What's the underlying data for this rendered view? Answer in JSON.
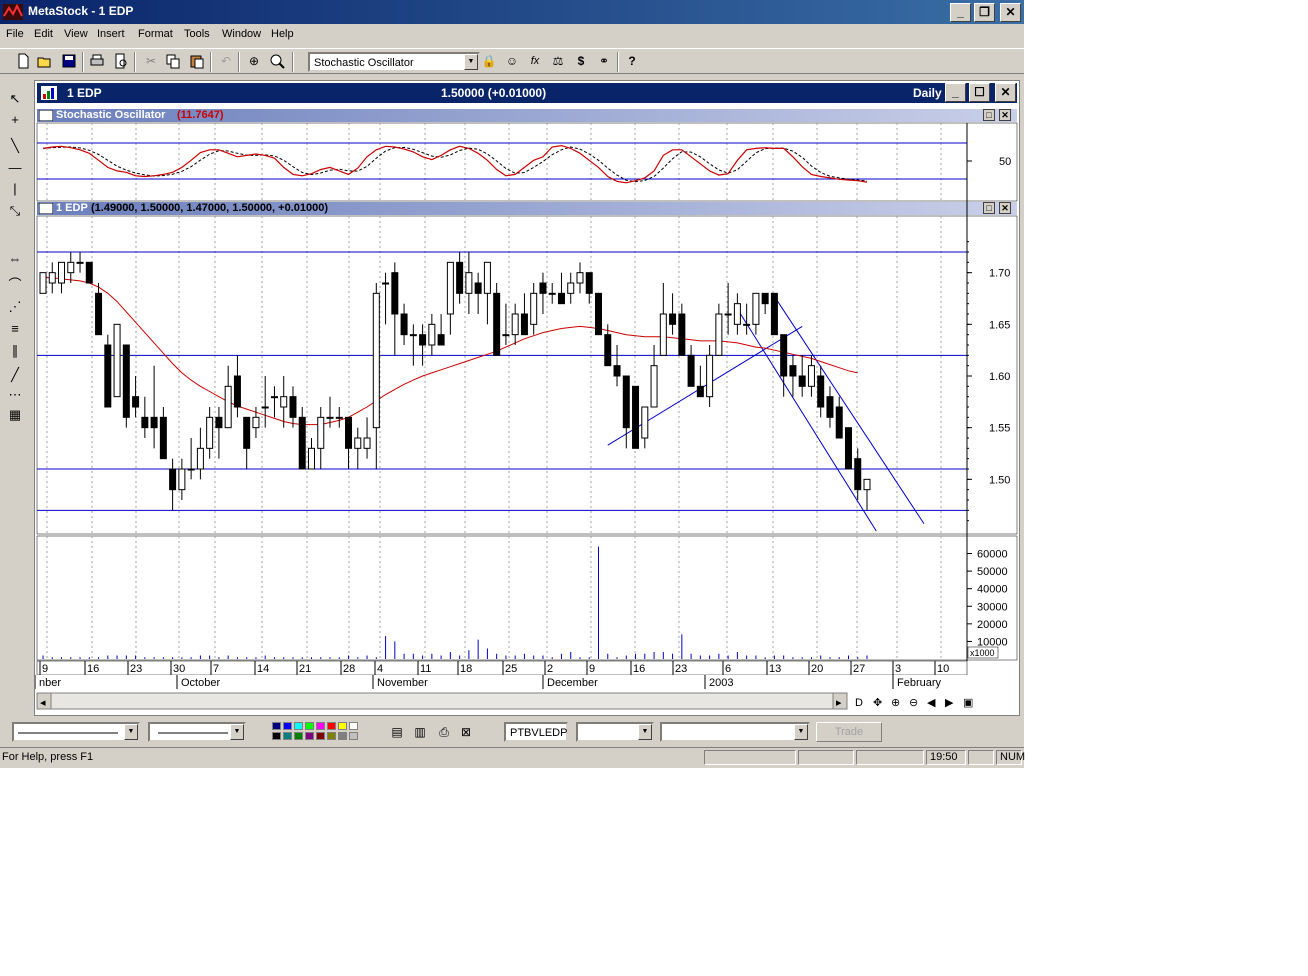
{
  "window": {
    "title": "MetaStock - 1 EDP",
    "minimize": "_",
    "restore": "❐",
    "close": "✕"
  },
  "menu": [
    "File",
    "Edit",
    "View",
    "Insert",
    "Format",
    "Tools",
    "Window",
    "Help"
  ],
  "toolbar": {
    "indicator_select": "Stochastic Oscillator",
    "indicator_icons": [
      "lock-icon",
      "expert-icon",
      "formula-icon",
      "system-icon",
      "dollar-icon",
      "binoculars-icon",
      "help-icon"
    ],
    "help_label": "?"
  },
  "chart_window": {
    "title": "1 EDP",
    "price_readout": "1.50000 (+0.01000)",
    "periodicity": "Daily"
  },
  "stochastic_panel": {
    "label": "Stochastic Oscillator",
    "value": "(11.7647)",
    "axis_tick": "50",
    "colors": {
      "k": "#cc0000",
      "d": "#000000",
      "levels": "#0000cc"
    }
  },
  "price_panel": {
    "label": "1 EDP",
    "ohlc": "(1.49000, 1.50000, 1.47000, 1.50000, +0.01000)",
    "axis_ticks": [
      "1.70",
      "1.65",
      "1.60",
      "1.55",
      "1.50"
    ],
    "ma_color": "#cc0000",
    "line_color": "#0000cc"
  },
  "volume_panel": {
    "axis_ticks": [
      "60000",
      "50000",
      "40000",
      "30000",
      "20000",
      "10000"
    ],
    "scale_label": "x1000"
  },
  "date_axis": {
    "days": [
      "9",
      "16",
      "23",
      "30",
      "7",
      "14",
      "21",
      "28",
      "4",
      "11",
      "18",
      "25",
      "2",
      "9",
      "16",
      "23",
      "6",
      "13",
      "20",
      "27",
      "3",
      "10"
    ],
    "months": [
      "nber",
      "October",
      "November",
      "December",
      "2003",
      "February"
    ]
  },
  "chart_data": {
    "type": "candlestick",
    "ylim": [
      1.45,
      1.75
    ],
    "candles": [
      {
        "o": 1.68,
        "h": 1.7,
        "l": 1.68,
        "c": 1.7
      },
      {
        "o": 1.69,
        "h": 1.71,
        "l": 1.68,
        "c": 1.7
      },
      {
        "o": 1.69,
        "h": 1.71,
        "l": 1.68,
        "c": 1.71
      },
      {
        "o": 1.7,
        "h": 1.72,
        "l": 1.69,
        "c": 1.71
      },
      {
        "o": 1.71,
        "h": 1.72,
        "l": 1.7,
        "c": 1.71
      },
      {
        "o": 1.71,
        "h": 1.71,
        "l": 1.69,
        "c": 1.69
      },
      {
        "o": 1.68,
        "h": 1.69,
        "l": 1.64,
        "c": 1.64
      },
      {
        "o": 1.63,
        "h": 1.64,
        "l": 1.57,
        "c": 1.57
      },
      {
        "o": 1.58,
        "h": 1.65,
        "l": 1.58,
        "c": 1.65
      },
      {
        "o": 1.63,
        "h": 1.63,
        "l": 1.55,
        "c": 1.56
      },
      {
        "o": 1.58,
        "h": 1.6,
        "l": 1.56,
        "c": 1.57
      },
      {
        "o": 1.56,
        "h": 1.58,
        "l": 1.54,
        "c": 1.55
      },
      {
        "o": 1.56,
        "h": 1.61,
        "l": 1.53,
        "c": 1.55
      },
      {
        "o": 1.56,
        "h": 1.57,
        "l": 1.52,
        "c": 1.52
      },
      {
        "o": 1.51,
        "h": 1.52,
        "l": 1.47,
        "c": 1.49
      },
      {
        "o": 1.49,
        "h": 1.52,
        "l": 1.48,
        "c": 1.51
      },
      {
        "o": 1.51,
        "h": 1.54,
        "l": 1.5,
        "c": 1.51
      },
      {
        "o": 1.51,
        "h": 1.55,
        "l": 1.5,
        "c": 1.53
      },
      {
        "o": 1.53,
        "h": 1.57,
        "l": 1.52,
        "c": 1.56
      },
      {
        "o": 1.56,
        "h": 1.57,
        "l": 1.52,
        "c": 1.55
      },
      {
        "o": 1.55,
        "h": 1.61,
        "l": 1.55,
        "c": 1.59
      },
      {
        "o": 1.6,
        "h": 1.62,
        "l": 1.56,
        "c": 1.57
      },
      {
        "o": 1.56,
        "h": 1.56,
        "l": 1.51,
        "c": 1.53
      },
      {
        "o": 1.55,
        "h": 1.57,
        "l": 1.54,
        "c": 1.56
      },
      {
        "o": 1.57,
        "h": 1.6,
        "l": 1.55,
        "c": 1.57
      },
      {
        "o": 1.58,
        "h": 1.59,
        "l": 1.56,
        "c": 1.58
      },
      {
        "o": 1.57,
        "h": 1.6,
        "l": 1.55,
        "c": 1.58
      },
      {
        "o": 1.58,
        "h": 1.59,
        "l": 1.55,
        "c": 1.56
      },
      {
        "o": 1.56,
        "h": 1.57,
        "l": 1.51,
        "c": 1.51
      },
      {
        "o": 1.51,
        "h": 1.54,
        "l": 1.51,
        "c": 1.53
      },
      {
        "o": 1.53,
        "h": 1.57,
        "l": 1.51,
        "c": 1.56
      },
      {
        "o": 1.56,
        "h": 1.58,
        "l": 1.55,
        "c": 1.56
      },
      {
        "o": 1.56,
        "h": 1.57,
        "l": 1.55,
        "c": 1.56
      },
      {
        "o": 1.56,
        "h": 1.56,
        "l": 1.51,
        "c": 1.53
      },
      {
        "o": 1.53,
        "h": 1.55,
        "l": 1.51,
        "c": 1.54
      },
      {
        "o": 1.53,
        "h": 1.56,
        "l": 1.52,
        "c": 1.54
      },
      {
        "o": 1.55,
        "h": 1.69,
        "l": 1.51,
        "c": 1.68
      },
      {
        "o": 1.69,
        "h": 1.7,
        "l": 1.65,
        "c": 1.69
      },
      {
        "o": 1.7,
        "h": 1.71,
        "l": 1.62,
        "c": 1.66
      },
      {
        "o": 1.66,
        "h": 1.67,
        "l": 1.63,
        "c": 1.64
      },
      {
        "o": 1.64,
        "h": 1.65,
        "l": 1.61,
        "c": 1.64
      },
      {
        "o": 1.64,
        "h": 1.65,
        "l": 1.61,
        "c": 1.63
      },
      {
        "o": 1.63,
        "h": 1.66,
        "l": 1.62,
        "c": 1.65
      },
      {
        "o": 1.64,
        "h": 1.66,
        "l": 1.63,
        "c": 1.63
      },
      {
        "o": 1.66,
        "h": 1.71,
        "l": 1.64,
        "c": 1.71
      },
      {
        "o": 1.71,
        "h": 1.72,
        "l": 1.67,
        "c": 1.68
      },
      {
        "o": 1.68,
        "h": 1.72,
        "l": 1.66,
        "c": 1.7
      },
      {
        "o": 1.69,
        "h": 1.7,
        "l": 1.66,
        "c": 1.68
      },
      {
        "o": 1.68,
        "h": 1.71,
        "l": 1.65,
        "c": 1.71
      },
      {
        "o": 1.68,
        "h": 1.69,
        "l": 1.62,
        "c": 1.62
      },
      {
        "o": 1.64,
        "h": 1.67,
        "l": 1.63,
        "c": 1.64
      },
      {
        "o": 1.64,
        "h": 1.67,
        "l": 1.63,
        "c": 1.66
      },
      {
        "o": 1.66,
        "h": 1.68,
        "l": 1.64,
        "c": 1.64
      },
      {
        "o": 1.65,
        "h": 1.69,
        "l": 1.64,
        "c": 1.68
      },
      {
        "o": 1.69,
        "h": 1.7,
        "l": 1.66,
        "c": 1.68
      },
      {
        "o": 1.68,
        "h": 1.69,
        "l": 1.67,
        "c": 1.68
      },
      {
        "o": 1.68,
        "h": 1.7,
        "l": 1.67,
        "c": 1.67
      },
      {
        "o": 1.68,
        "h": 1.7,
        "l": 1.67,
        "c": 1.69
      },
      {
        "o": 1.69,
        "h": 1.71,
        "l": 1.68,
        "c": 1.7
      },
      {
        "o": 1.7,
        "h": 1.7,
        "l": 1.67,
        "c": 1.68
      },
      {
        "o": 1.68,
        "h": 1.68,
        "l": 1.64,
        "c": 1.64
      },
      {
        "o": 1.64,
        "h": 1.65,
        "l": 1.61,
        "c": 1.61
      },
      {
        "o": 1.61,
        "h": 1.63,
        "l": 1.59,
        "c": 1.6
      },
      {
        "o": 1.6,
        "h": 1.6,
        "l": 1.53,
        "c": 1.55
      },
      {
        "o": 1.59,
        "h": 1.59,
        "l": 1.53,
        "c": 1.53
      },
      {
        "o": 1.54,
        "h": 1.57,
        "l": 1.53,
        "c": 1.57
      },
      {
        "o": 1.57,
        "h": 1.63,
        "l": 1.57,
        "c": 1.61
      },
      {
        "o": 1.62,
        "h": 1.69,
        "l": 1.62,
        "c": 1.66
      },
      {
        "o": 1.66,
        "h": 1.68,
        "l": 1.64,
        "c": 1.65
      },
      {
        "o": 1.66,
        "h": 1.67,
        "l": 1.62,
        "c": 1.62
      },
      {
        "o": 1.62,
        "h": 1.63,
        "l": 1.59,
        "c": 1.59
      },
      {
        "o": 1.59,
        "h": 1.61,
        "l": 1.58,
        "c": 1.58
      },
      {
        "o": 1.58,
        "h": 1.63,
        "l": 1.57,
        "c": 1.62
      },
      {
        "o": 1.62,
        "h": 1.67,
        "l": 1.62,
        "c": 1.66
      },
      {
        "o": 1.66,
        "h": 1.69,
        "l": 1.64,
        "c": 1.66
      },
      {
        "o": 1.65,
        "h": 1.68,
        "l": 1.64,
        "c": 1.67
      },
      {
        "o": 1.65,
        "h": 1.67,
        "l": 1.64,
        "c": 1.65
      },
      {
        "o": 1.65,
        "h": 1.68,
        "l": 1.64,
        "c": 1.68
      },
      {
        "o": 1.68,
        "h": 1.68,
        "l": 1.66,
        "c": 1.67
      },
      {
        "o": 1.68,
        "h": 1.68,
        "l": 1.64,
        "c": 1.64
      },
      {
        "o": 1.64,
        "h": 1.64,
        "l": 1.58,
        "c": 1.6
      },
      {
        "o": 1.61,
        "h": 1.62,
        "l": 1.58,
        "c": 1.6
      },
      {
        "o": 1.6,
        "h": 1.62,
        "l": 1.58,
        "c": 1.59
      },
      {
        "o": 1.59,
        "h": 1.62,
        "l": 1.58,
        "c": 1.61
      },
      {
        "o": 1.6,
        "h": 1.61,
        "l": 1.56,
        "c": 1.57
      },
      {
        "o": 1.58,
        "h": 1.59,
        "l": 1.55,
        "c": 1.56
      },
      {
        "o": 1.57,
        "h": 1.58,
        "l": 1.54,
        "c": 1.54
      },
      {
        "o": 1.55,
        "h": 1.55,
        "l": 1.51,
        "c": 1.51
      },
      {
        "o": 1.52,
        "h": 1.53,
        "l": 1.48,
        "c": 1.49
      },
      {
        "o": 1.49,
        "h": 1.5,
        "l": 1.47,
        "c": 1.5
      }
    ],
    "ma": [
      1.695,
      1.695,
      1.694,
      1.693,
      1.692,
      1.69,
      1.686,
      1.68,
      1.672,
      1.662,
      1.652,
      1.642,
      1.632,
      1.622,
      1.612,
      1.603,
      1.596,
      1.59,
      1.585,
      1.58,
      1.575,
      1.571,
      1.568,
      1.565,
      1.562,
      1.559,
      1.556,
      1.554,
      1.553,
      1.553,
      1.553,
      1.555,
      1.557,
      1.56,
      1.565,
      1.57,
      1.576,
      1.582,
      1.587,
      1.592,
      1.596,
      1.6,
      1.603,
      1.606,
      1.609,
      1.612,
      1.615,
      1.618,
      1.621,
      1.624,
      1.628,
      1.632,
      1.636,
      1.639,
      1.642,
      1.644,
      1.646,
      1.647,
      1.648,
      1.647,
      1.646,
      1.644,
      1.642,
      1.64,
      1.639,
      1.638,
      1.638,
      1.638,
      1.637,
      1.636,
      1.635,
      1.634,
      1.634,
      1.634,
      1.633,
      1.632,
      1.63,
      1.628,
      1.627,
      1.625,
      1.623,
      1.621,
      1.619,
      1.617,
      1.614,
      1.611,
      1.608,
      1.605,
      1.603
    ],
    "volume": [
      2,
      1,
      1,
      1,
      1,
      1,
      1,
      2,
      2,
      2,
      2,
      1,
      1,
      1,
      1,
      1,
      1,
      2,
      2,
      1,
      2,
      1,
      1,
      1,
      2,
      1,
      1,
      1,
      1,
      1,
      1,
      1,
      1,
      2,
      1,
      2,
      1,
      13,
      10,
      3,
      3,
      2,
      3,
      2,
      4,
      2,
      5,
      11,
      6,
      3,
      2,
      2,
      3,
      2,
      2,
      1,
      3,
      4,
      1,
      1,
      64,
      3,
      1,
      2,
      3,
      3,
      4,
      4,
      3,
      14,
      3,
      2,
      2,
      3,
      2,
      4,
      2,
      2,
      1,
      2,
      2,
      1,
      1,
      1,
      2,
      1,
      1,
      2,
      1,
      2
    ],
    "stoch_k": [
      72,
      74,
      75,
      73,
      70,
      65,
      55,
      45,
      40,
      38,
      33,
      32,
      33,
      35,
      38,
      45,
      55,
      66,
      70,
      70,
      65,
      60,
      62,
      64,
      62,
      58,
      45,
      35,
      33,
      36,
      42,
      45,
      40,
      35,
      44,
      60,
      70,
      75,
      74,
      71,
      67,
      60,
      56,
      62,
      70,
      75,
      72,
      65,
      55,
      42,
      33,
      35,
      45,
      55,
      60,
      74,
      76,
      72,
      65,
      55,
      45,
      32,
      25,
      23,
      26,
      30,
      40,
      62,
      70,
      70,
      60,
      50,
      40,
      34,
      36,
      55,
      70,
      72,
      73,
      72,
      72,
      60,
      46,
      35,
      32,
      30,
      28,
      27,
      26,
      24
    ]
  },
  "bottom_bar": {
    "line_style_1": "",
    "line_style_2": "",
    "security": "PTBVLEDP",
    "trade_label": "Trade",
    "palette": [
      "#000080",
      "#0000ff",
      "#00ffff",
      "#00ff00",
      "#ff00ff",
      "#ff0000",
      "#ffff00",
      "#ffffff",
      "#000000",
      "#008080",
      "#008000",
      "#800080",
      "#800000",
      "#808000",
      "#808080",
      "#c0c0c0"
    ]
  },
  "status_bar": {
    "help": "For Help, press F1",
    "time": "19:50",
    "num": "NUM"
  },
  "scroll_buttons": [
    "◂",
    "▸",
    "D",
    "✥",
    "⊕",
    "⊖",
    "◀",
    "▶",
    "▣"
  ]
}
